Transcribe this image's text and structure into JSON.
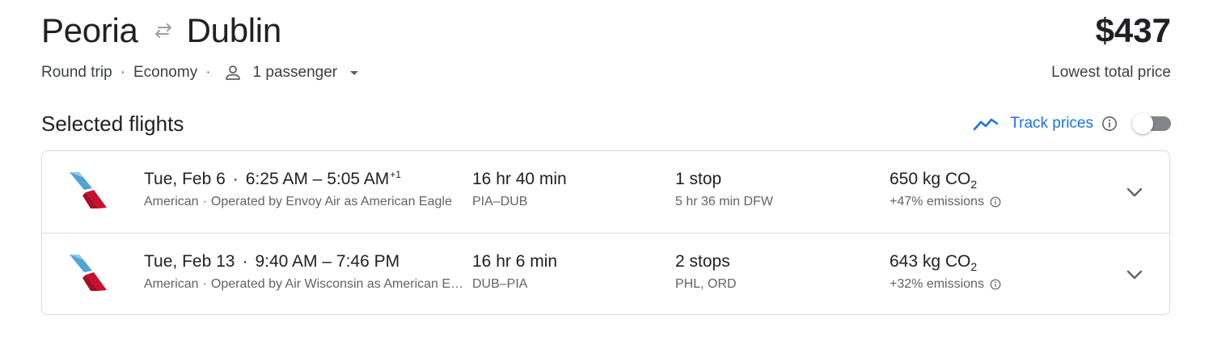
{
  "header": {
    "origin": "Peoria",
    "destination": "Dublin",
    "price": "$437",
    "price_caption": "Lowest total price",
    "trip_type": "Round trip",
    "cabin": "Economy",
    "passengers": "1 passenger",
    "swap_icon": "swap-arrows-icon",
    "passenger_icon": "person-icon",
    "dropdown_icon": "caret-down-icon"
  },
  "section": {
    "title": "Selected flights",
    "track_label": "Track prices",
    "track_toggle_on": false,
    "accent_color": "#1a73e8"
  },
  "flights": [
    {
      "date": "Tue, Feb 6",
      "depart": "6:25 AM",
      "arrive": "5:05 AM",
      "day_offset": "+1",
      "airline": "American",
      "operator": "Operated by Envoy Air as American Eagle",
      "duration": "16 hr 40 min",
      "route": "PIA–DUB",
      "stops": "1 stop",
      "layover": "5 hr 36 min DFW",
      "emissions_value": "650 kg CO",
      "emissions_sub": "2",
      "emissions_pct": "+47% emissions"
    },
    {
      "date": "Tue, Feb 13",
      "depart": "9:40 AM",
      "arrive": "7:46 PM",
      "day_offset": "",
      "airline": "American",
      "operator": "Operated by Air Wisconsin as American Eagle",
      "duration": "16 hr 6 min",
      "route": "DUB–PIA",
      "stops": "2 stops",
      "layover": "PHL, ORD",
      "emissions_value": "643 kg CO",
      "emissions_sub": "2",
      "emissions_pct": "+32% emissions"
    }
  ]
}
